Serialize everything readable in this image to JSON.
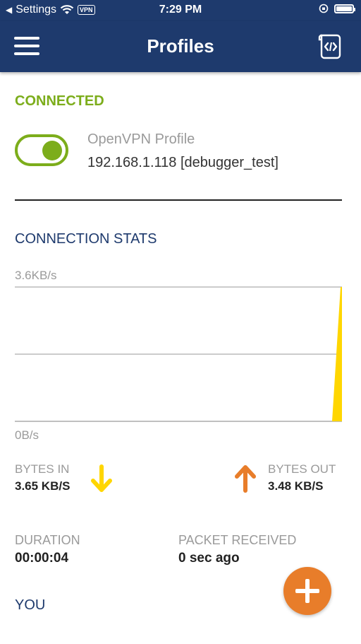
{
  "status_bar": {
    "back_label": "Settings",
    "vpn_badge": "VPN",
    "time": "7:29 PM"
  },
  "header": {
    "title": "Profiles"
  },
  "connection": {
    "status": "CONNECTED",
    "toggle_on": true,
    "profile_name": "OpenVPN Profile",
    "server": "192.168.1.118 [debugger_test]"
  },
  "stats": {
    "title": "CONNECTION STATS",
    "bytes_in_label": "BYTES IN",
    "bytes_in_value": "3.65 KB/S",
    "bytes_out_label": "BYTES OUT",
    "bytes_out_value": "3.48 KB/S",
    "duration_label": "DURATION",
    "duration_value": "00:00:04",
    "packet_label": "PACKET RECEIVED",
    "packet_value": "0 sec ago"
  },
  "you": {
    "title": "YOU"
  },
  "colors": {
    "header_bg": "#1e3a6d",
    "connected_green": "#7cad1b",
    "bytes_in_yellow": "#ffd600",
    "bytes_out_orange": "#e87d2a"
  },
  "chart_data": {
    "type": "area",
    "y_max_label": "3.6KB/s",
    "y_min_label": "0B/s",
    "ylim": [
      0,
      3.6
    ],
    "x": [
      0,
      1,
      2,
      3,
      4
    ],
    "values": [
      0,
      0,
      0,
      0,
      3.65
    ],
    "grid": true
  }
}
